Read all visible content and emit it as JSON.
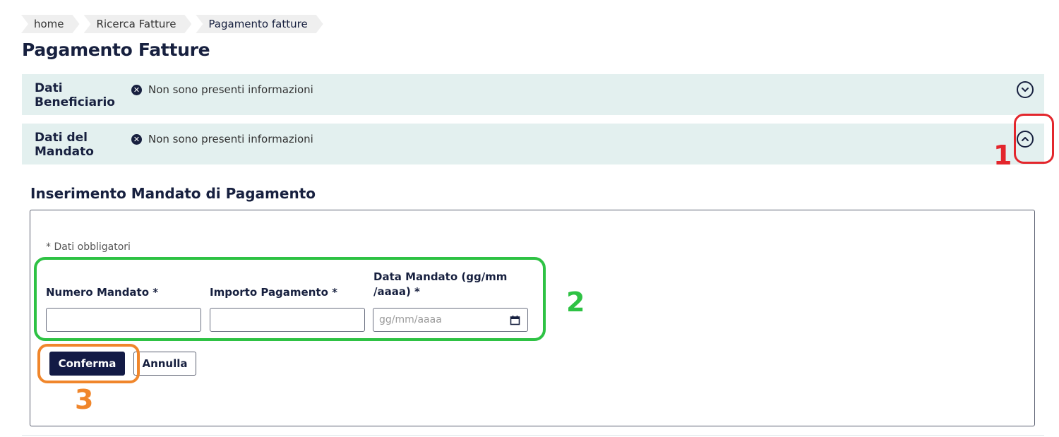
{
  "breadcrumb": {
    "items": [
      {
        "label": "home"
      },
      {
        "label": "Ricerca Fatture"
      },
      {
        "label": "Pagamento fatture"
      }
    ]
  },
  "page": {
    "title": "Pagamento Fatture"
  },
  "accordions": [
    {
      "title": "Dati Beneficiario",
      "info": "Non sono presenti informazioni",
      "toggle_icon": "chevron-down-icon"
    },
    {
      "title": "Dati del Mandato",
      "info": "Non sono presenti informazioni",
      "toggle_icon": "chevron-up-icon"
    }
  ],
  "form": {
    "section_title": "Inserimento Mandato di Pagamento",
    "required_note": "* Dati obbligatori",
    "fields": {
      "numero_mandato": {
        "label": "Numero Mandato *",
        "value": ""
      },
      "importo_pagamento": {
        "label": "Importo Pagamento *",
        "value": ""
      },
      "data_mandato": {
        "label": "Data Mandato (gg/mm /aaaa) *",
        "placeholder": "gg/mm/aaaa",
        "value": "",
        "icon": "calendar-icon"
      }
    },
    "buttons": {
      "confirm": "Conferma",
      "cancel": "Annulla"
    }
  },
  "annotations": {
    "one": "1",
    "two": "2",
    "three": "3"
  },
  "colors": {
    "primary": "#131a45",
    "accordion_bg": "#e3f0ef",
    "annotation_red": "#e3262c",
    "annotation_green": "#2ec244",
    "annotation_orange": "#f0862b"
  }
}
